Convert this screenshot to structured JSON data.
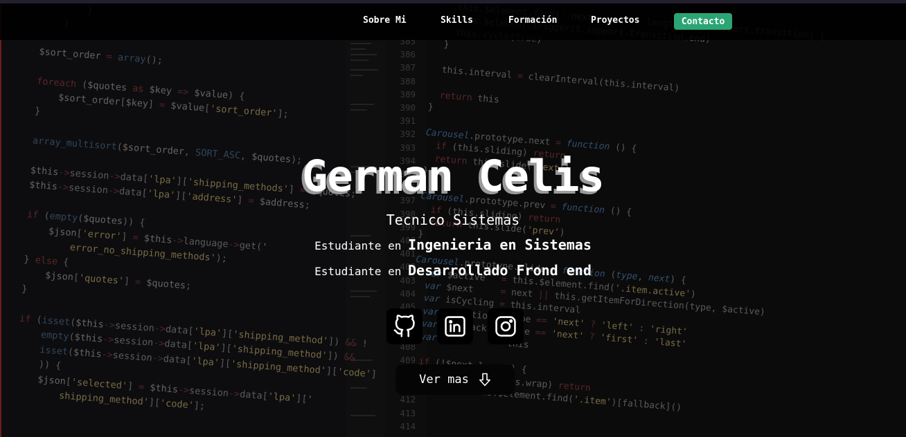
{
  "nav": {
    "items": [
      "Sobre Mi",
      "Skills",
      "Formación",
      "Proyectos"
    ],
    "contact_label": "Contacto",
    "contact_color": "#2ba573"
  },
  "hero": {
    "name": "German Celis",
    "subtitle": "Tecnico Sistemas",
    "lines": [
      {
        "prefix": "Estudiante en",
        "highlight": "Ingenieria en Sistemas"
      },
      {
        "prefix": "Estudiante en",
        "highlight": "Desarrollado Frond end"
      }
    ]
  },
  "social": [
    {
      "name": "github-icon"
    },
    {
      "name": "linkedin-icon"
    },
    {
      "name": "instagram-icon"
    }
  ],
  "cta": {
    "label": "Ver mas",
    "icon": "arrow-down-icon"
  }
}
